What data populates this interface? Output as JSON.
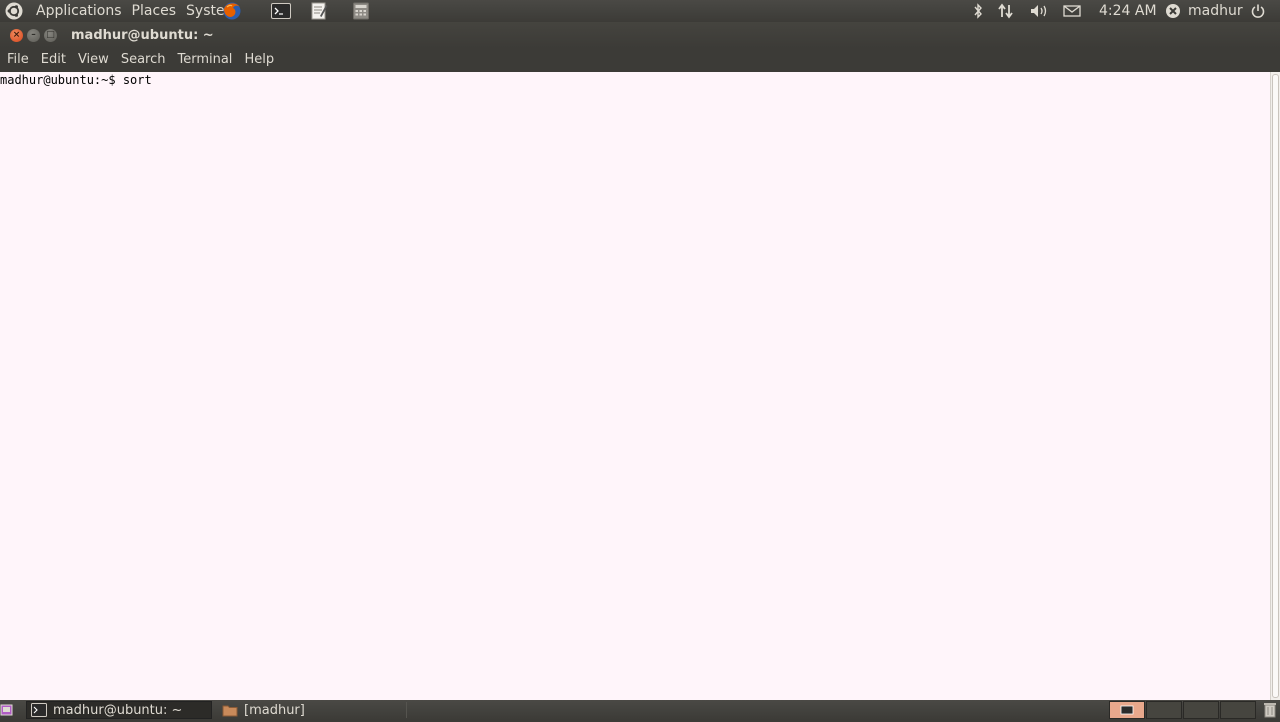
{
  "top_panel": {
    "menus": [
      "Applications",
      "Places",
      "System"
    ],
    "launchers": [
      "firefox-icon",
      "terminal-launcher-icon",
      "text-editor-icon",
      "calculator-icon"
    ],
    "tray": {
      "icons": [
        "bluetooth-icon",
        "network-icon",
        "volume-icon",
        "mail-icon"
      ],
      "clock": "4:24 AM",
      "user": "madhur"
    }
  },
  "window": {
    "title": "madhur@ubuntu: ~",
    "menu": [
      "File",
      "Edit",
      "View",
      "Search",
      "Terminal",
      "Help"
    ]
  },
  "terminal": {
    "lines": [
      "madhur@ubuntu:~$ sort"
    ]
  },
  "bottom_panel": {
    "tasks": [
      {
        "label": "madhur@ubuntu: ~",
        "icon": "terminal-icon",
        "active": true
      },
      {
        "label": "[madhur]",
        "icon": "folder-icon",
        "active": false
      }
    ]
  },
  "colors": {
    "panel": "#3c3b37",
    "terminal_bg": "#fff5fa",
    "close_button": "#e05a2b",
    "panel_text": "#dfdbd2"
  }
}
